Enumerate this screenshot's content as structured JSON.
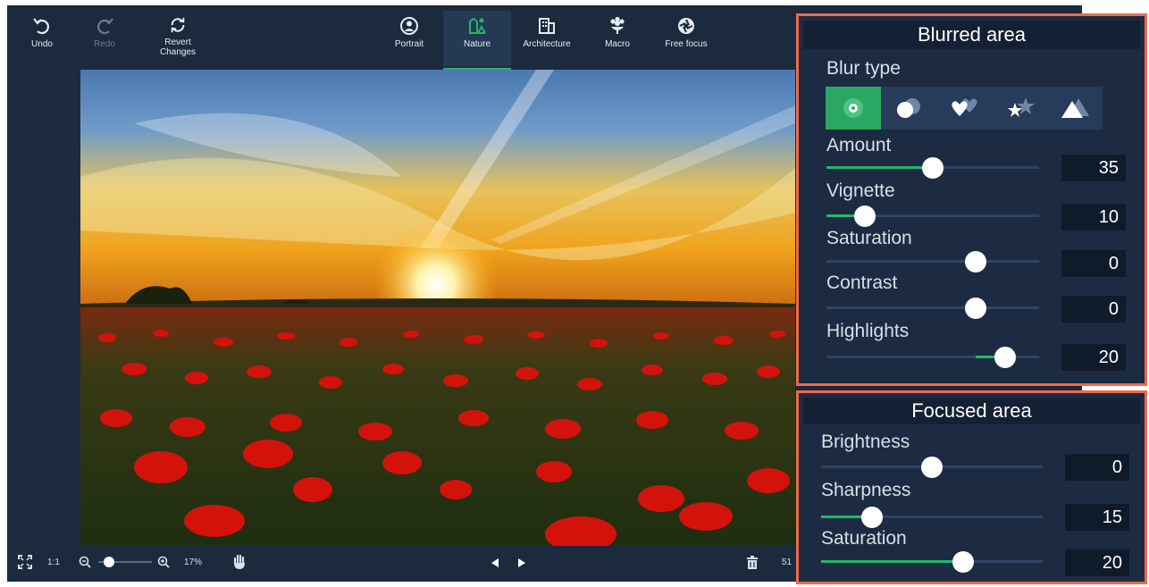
{
  "toolbar": {
    "undo": "Undo",
    "redo": "Redo",
    "revert_line1": "Revert",
    "revert_line2": "Changes",
    "modes": [
      {
        "label": "Portrait",
        "icon": "portrait-icon",
        "active": false
      },
      {
        "label": "Nature",
        "icon": "nature-icon",
        "active": true
      },
      {
        "label": "Architecture",
        "icon": "architecture-icon",
        "active": false
      },
      {
        "label": "Macro",
        "icon": "macro-icon",
        "active": false
      },
      {
        "label": "Free focus",
        "icon": "free-focus-icon",
        "active": false
      }
    ]
  },
  "bottom_bar": {
    "ratio": "1:1",
    "zoom": "17%",
    "zoom_level": 0.2,
    "page_fragment": "51"
  },
  "blurred_area": {
    "title": "Blurred area",
    "blur_type_label": "Blur type",
    "blur_types": [
      "circle-blur-icon",
      "overlapping-circles-icon",
      "hearts-icon",
      "stars-icon",
      "triangles-icon"
    ],
    "selected_blur_type": 0,
    "sliders": [
      {
        "label": "Amount",
        "value": "35",
        "fill_from": 0,
        "position": 0.5
      },
      {
        "label": "Vignette",
        "value": "10",
        "fill_from": 0,
        "position": 0.18
      },
      {
        "label": "Saturation",
        "value": "0",
        "fill_from": 0.7,
        "position": 0.7
      },
      {
        "label": "Contrast",
        "value": "0",
        "fill_from": 0.7,
        "position": 0.7
      },
      {
        "label": "Highlights",
        "value": "20",
        "fill_from": 0.7,
        "position": 0.84
      }
    ]
  },
  "focused_area": {
    "title": "Focused area",
    "sliders": [
      {
        "label": "Brightness",
        "value": "0",
        "fill_from": 0.5,
        "position": 0.5
      },
      {
        "label": "Sharpness",
        "value": "15",
        "fill_from": 0,
        "position": 0.23
      },
      {
        "label": "Saturation",
        "value": "20",
        "fill_from": 0,
        "position": 0.64
      }
    ]
  },
  "colors": {
    "accent_green": "#2aa862",
    "panel_border": "#ef6a4a",
    "panel_bg": "#1d2b42",
    "app_bg": "#1c2a3e"
  }
}
